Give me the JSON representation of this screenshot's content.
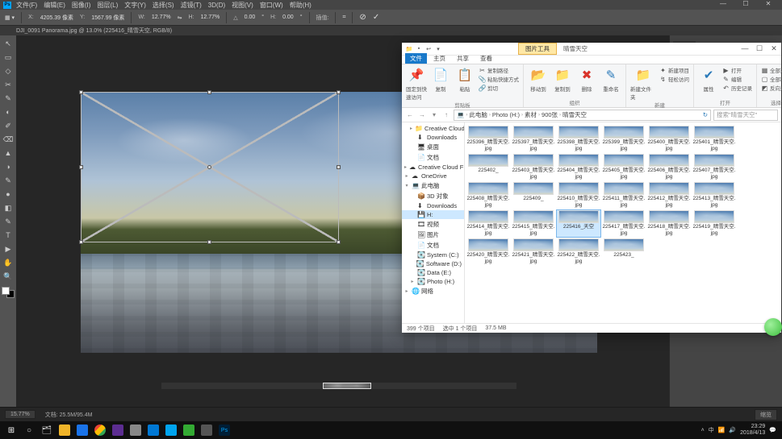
{
  "ps": {
    "menus": [
      "文件(F)",
      "编辑(E)",
      "图像(I)",
      "图层(L)",
      "文字(Y)",
      "选择(S)",
      "滤镜(T)",
      "3D(D)",
      "视图(V)",
      "窗口(W)",
      "帮助(H)"
    ],
    "opt": {
      "x_label": "X:",
      "x": "4205.39 像素",
      "y_label": "Y:",
      "y": "1567.99 像素",
      "w_label": "W:",
      "w": "12.77%",
      "h_label": "H:",
      "h": "12.77%",
      "angle_label": "△",
      "angle": "0.00",
      "skew_label": "H:",
      "skew": "0.00",
      "interp": "插值:"
    },
    "docTab": "DJI_0091 Panorama.jpg @ 13.0% (225416_晴雪天空, RGB/8)",
    "rightPanel": "属性",
    "statusZoom": "15.77%",
    "statusDoc": "文档: 25.5M/95.4M",
    "statusThumb": "缩览",
    "tools": [
      "↖",
      "▭",
      "◇",
      "✂",
      "✎",
      "◐",
      "✐",
      "⌫",
      "▲",
      "◑",
      "✎",
      "●",
      "◧",
      "✎",
      "T",
      "▶",
      "✋",
      "🔍"
    ]
  },
  "explorer": {
    "tabs": {
      "file": "文件",
      "home": "主页",
      "share": "共享",
      "view": "查看",
      "picture": "图片工具",
      "title": "晴雪天空"
    },
    "ribbon": {
      "g1": {
        "label": "剪贴板",
        "pin": "固定到快速访问",
        "copy": "复制",
        "paste": "粘贴",
        "cut": "复制路径",
        "path": "粘贴快捷方式",
        "shortcut": "剪切"
      },
      "g2": {
        "label": "组织",
        "move": "移动到",
        "copy": "复制到",
        "delete": "删除",
        "rename": "重命名"
      },
      "g3": {
        "label": "新建",
        "folder": "新建文件夹",
        "newitem": "新建项目",
        "easy": "轻松访问"
      },
      "g4": {
        "label": "打开",
        "props": "属性",
        "edit": "编辑",
        "open": "打开",
        "hist": "历史记录"
      },
      "g5": {
        "label": "选择",
        "all": "全部选择",
        "none": "全部取消",
        "inv": "反向选择"
      }
    },
    "crumbs": [
      "此电脑",
      "Photo (H:)",
      "素材",
      "900张",
      "晴雪天空"
    ],
    "searchPlaceholder": "搜索\"晴雪天空\"",
    "tree": [
      {
        "t": "Creative Cloud F",
        "i": "📁",
        "ind": 1,
        "exp": "▸"
      },
      {
        "t": "Downloads",
        "i": "⬇",
        "ind": 1,
        "exp": ""
      },
      {
        "t": "桌面",
        "i": "🖥",
        "ind": 1,
        "exp": ""
      },
      {
        "t": "文档",
        "i": "📄",
        "ind": 1,
        "exp": ""
      },
      {
        "t": "Creative Cloud F",
        "i": "☁",
        "ind": 0,
        "exp": "▸"
      },
      {
        "t": "OneDrive",
        "i": "☁",
        "ind": 0,
        "exp": "▸"
      },
      {
        "t": "此电脑",
        "i": "💻",
        "ind": 0,
        "exp": "▾"
      },
      {
        "t": "3D 对象",
        "i": "📦",
        "ind": 1,
        "exp": ""
      },
      {
        "t": "Downloads",
        "i": "⬇",
        "ind": 1,
        "exp": ""
      },
      {
        "t": "H:",
        "i": "💾",
        "ind": 1,
        "exp": "",
        "sel": true
      },
      {
        "t": "视频",
        "i": "🎞",
        "ind": 1,
        "exp": ""
      },
      {
        "t": "图片",
        "i": "🖼",
        "ind": 1,
        "exp": ""
      },
      {
        "t": "文档",
        "i": "📄",
        "ind": 1,
        "exp": ""
      },
      {
        "t": "System (C:)",
        "i": "💽",
        "ind": 1,
        "exp": ""
      },
      {
        "t": "Software (D:)",
        "i": "💽",
        "ind": 1,
        "exp": ""
      },
      {
        "t": "Data (E:)",
        "i": "💽",
        "ind": 1,
        "exp": ""
      },
      {
        "t": "Photo (H:)",
        "i": "💽",
        "ind": 1,
        "exp": "▸"
      },
      {
        "t": "网络",
        "i": "🌐",
        "ind": 0,
        "exp": "▸"
      }
    ],
    "files": [
      "225396_晴雪天空.jpg",
      "225397_晴雪天空.jpg",
      "225398_晴雪天空.jpg",
      "225399_晴雪天空.jpg",
      "225400_晴雪天空.jpg",
      "225401_晴雪天空.jpg",
      "225402_",
      "225403_晴雪天空.jpg",
      "225404_晴雪天空.jpg",
      "225405_晴雪天空.jpg",
      "225406_晴雪天空.jpg",
      "225407_晴雪天空.jpg",
      "225408_晴雪天空.jpg",
      "225409_",
      "225410_晴雪天空.jpg",
      "225411_晴雪天空.jpg",
      "225412_晴雪天空.jpg",
      "225413_晴雪天空.jpg",
      "225414_晴雪天空.jpg",
      "225415_晴雪天空.jpg",
      "225416_天空",
      "225417_晴雪天空.jpg",
      "225418_晴雪天空.jpg",
      "225419_晴雪天空.jpg",
      "225420_晴雪天空.jpg",
      "225421_晴雪天空.jpg",
      "225422_晴雪天空.jpg",
      "225423_"
    ],
    "selectedIndex": 20,
    "status": {
      "count": "399 个项目",
      "sel": "选中 1 个项目",
      "size": "37.5 MB"
    }
  },
  "taskbar": {
    "items": [
      "⊞",
      "○",
      "🗂",
      "📁",
      "🌐",
      "🧩",
      "📓",
      "📑",
      "✉",
      "☁",
      "📝",
      "📷",
      "Ps"
    ],
    "tray": {
      "up": "˄",
      "ime": "中",
      "net": "📶",
      "vol": "🔊",
      "time": "23:29",
      "date": "2018/4/13"
    }
  }
}
